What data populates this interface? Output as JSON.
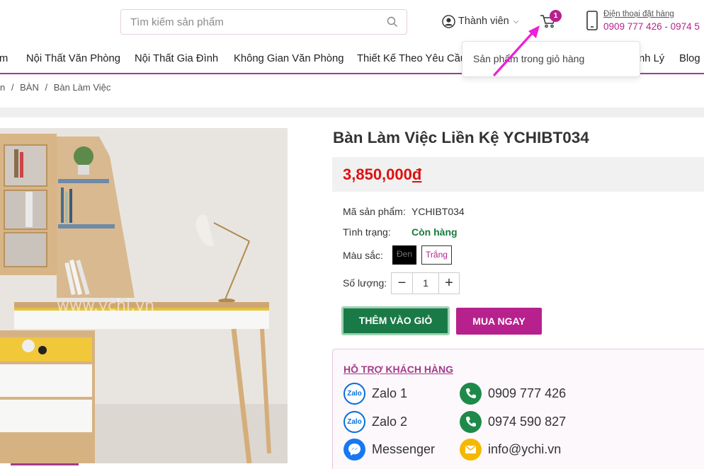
{
  "header": {
    "search_placeholder": "Tìm kiếm sản phẩm",
    "member_label": "Thành viên",
    "cart_count": "1",
    "phone_label": "Điện thoại đặt hàng",
    "phone_numbers": "0909 777 426 - 0974 5"
  },
  "nav": {
    "items": [
      "m",
      "Nội Thất Văn Phòng",
      "Nội Thất Gia Đình",
      "Không Gian Văn Phòng",
      "Thiết Kế Theo Yêu Cầu",
      "nh Lý",
      "Blog"
    ]
  },
  "cart_dropdown": {
    "text": "Sản phẩm trong giỏ hàng"
  },
  "breadcrumb": [
    "n",
    "/",
    "BÀN",
    "/",
    "Bàn Làm Việc"
  ],
  "product": {
    "title": "Bàn Làm Việc Liền Kệ YCHIBT034",
    "price": "3,850,000",
    "currency": "đ",
    "sku_label": "Mã sản phẩm:",
    "sku": "YCHIBT034",
    "status_label": "Tình trạng:",
    "status": "Còn hàng",
    "color_label": "Màu sắc:",
    "colors": [
      "Đen",
      "Trắng"
    ],
    "qty_label": "Số lượng:",
    "qty": "1",
    "add_to_cart": "THÊM VÀO GIỎ",
    "buy_now": "MUA NGAY",
    "watermark": "www.ychi.vn"
  },
  "support": {
    "title": "HỖ TRỢ KHÁCH HÀNG",
    "left": [
      {
        "icon": "zalo-icon",
        "label": "Zalo 1"
      },
      {
        "icon": "zalo-icon",
        "label": "Zalo 2"
      },
      {
        "icon": "messenger-icon",
        "label": "Messenger"
      }
    ],
    "right": [
      {
        "icon": "phone-icon",
        "label": "0909 777 426"
      },
      {
        "icon": "phone-icon",
        "label": "0974 590 827"
      },
      {
        "icon": "mail-icon",
        "label": "info@ychi.vn"
      }
    ],
    "zalo_text": "Zalo"
  },
  "colors": {
    "accent": "#b7218d",
    "green": "#1a7a47",
    "price_red": "#dd1111"
  }
}
